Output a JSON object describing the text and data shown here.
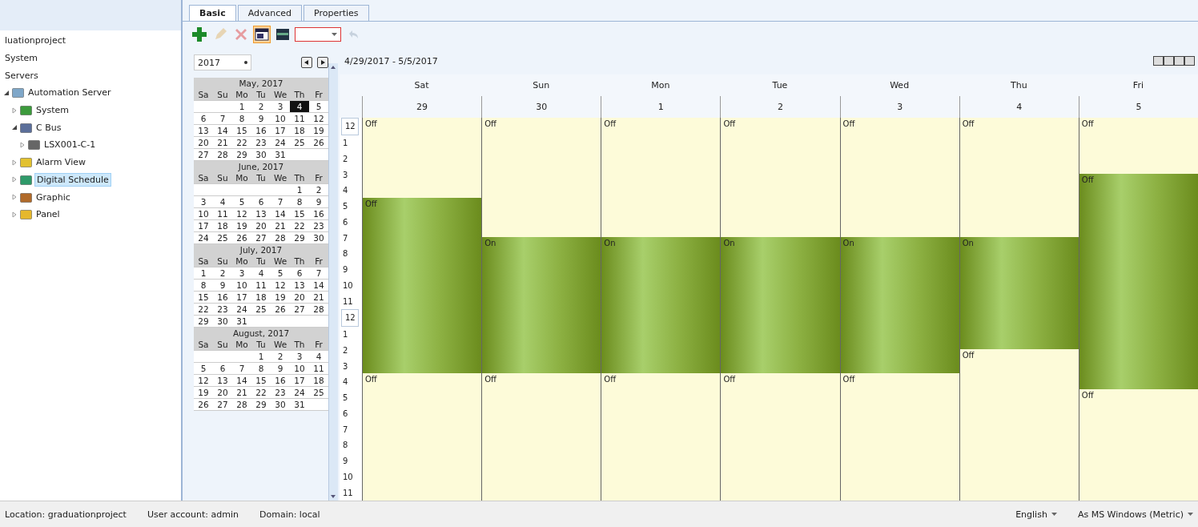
{
  "tree": {
    "items": [
      {
        "label": "luationproject",
        "kind": "plain",
        "selected": false
      },
      {
        "label": "System",
        "kind": "plain",
        "selected": false
      },
      {
        "label": "Servers",
        "kind": "plain",
        "selected": false
      },
      {
        "label": "Automation Server",
        "kind": "server",
        "selected": false,
        "expanded": true,
        "children": [
          {
            "label": "System",
            "kind": "system",
            "selected": false,
            "expanded": false
          },
          {
            "label": "C Bus",
            "kind": "bus",
            "selected": false,
            "expanded": true,
            "children": [
              {
                "label": "LSX001-C-1",
                "kind": "device",
                "selected": false,
                "expanded": false
              }
            ]
          },
          {
            "label": "Alarm View",
            "kind": "alarm",
            "selected": false,
            "expanded": false
          },
          {
            "label": "Digital Schedule",
            "kind": "schedule",
            "selected": true,
            "expanded": false
          },
          {
            "label": "Graphic",
            "kind": "graphic",
            "selected": false,
            "expanded": false
          },
          {
            "label": "Panel",
            "kind": "panel",
            "selected": false,
            "expanded": false
          }
        ]
      }
    ]
  },
  "tabs": [
    {
      "label": "Basic",
      "selected": true
    },
    {
      "label": "Advanced",
      "selected": false
    },
    {
      "label": "Properties",
      "selected": false
    }
  ],
  "toolbar": [
    {
      "kind": "add",
      "disabled": false,
      "selected": false
    },
    {
      "kind": "edit",
      "disabled": true,
      "selected": false
    },
    {
      "kind": "delete",
      "disabled": true,
      "selected": false
    },
    {
      "kind": "week",
      "disabled": false,
      "selected": true
    },
    {
      "kind": "list",
      "disabled": false,
      "selected": false
    },
    {
      "kind": "combo",
      "disabled": false,
      "selected": false
    },
    {
      "kind": "undo",
      "disabled": true,
      "selected": false
    }
  ],
  "year": {
    "value": "2017"
  },
  "mini_calendars": [
    {
      "title": "May, 2017",
      "weekdays": [
        "Sa",
        "Su",
        "Mo",
        "Tu",
        "We",
        "Th",
        "Fr"
      ],
      "weeks": [
        [
          {
            "day": "1",
            "selected": false
          },
          {
            "day": "2",
            "selected": false
          },
          {
            "day": "3",
            "selected": false
          },
          {
            "day": "4",
            "selected": true
          },
          {
            "day": "5",
            "selected": false
          }
        ],
        [
          {
            "day": "6",
            "selected": false
          },
          {
            "day": "7",
            "selected": false
          },
          {
            "day": "8",
            "selected": false
          },
          {
            "day": "9",
            "selected": false
          },
          {
            "day": "10",
            "selected": false
          },
          {
            "day": "11",
            "selected": false
          },
          {
            "day": "12",
            "selected": false
          }
        ],
        [
          {
            "day": "13",
            "selected": false
          },
          {
            "day": "14",
            "selected": false
          },
          {
            "day": "15",
            "selected": false
          },
          {
            "day": "16",
            "selected": false
          },
          {
            "day": "17",
            "selected": false
          },
          {
            "day": "18",
            "selected": false
          },
          {
            "day": "19",
            "selected": false
          }
        ],
        [
          {
            "day": "20",
            "selected": false
          },
          {
            "day": "21",
            "selected": false
          },
          {
            "day": "22",
            "selected": false
          },
          {
            "day": "23",
            "selected": false
          },
          {
            "day": "24",
            "selected": false
          },
          {
            "day": "25",
            "selected": false
          },
          {
            "day": "26",
            "selected": false
          }
        ],
        [
          {
            "day": "27",
            "selected": false
          },
          {
            "day": "28",
            "selected": false
          },
          {
            "day": "29",
            "selected": false
          },
          {
            "day": "30",
            "selected": false
          },
          {
            "day": "31",
            "selected": false
          }
        ]
      ]
    },
    {
      "title": "June, 2017",
      "weekdays": [
        "Sa",
        "Su",
        "Mo",
        "Tu",
        "We",
        "Th",
        "Fr"
      ],
      "weeks": [
        [
          {
            "day": "1",
            "selected": false
          },
          {
            "day": "2",
            "selected": false
          }
        ],
        [
          {
            "day": "3",
            "selected": false
          },
          {
            "day": "4",
            "selected": false
          },
          {
            "day": "5",
            "selected": false
          },
          {
            "day": "6",
            "selected": false
          },
          {
            "day": "7",
            "selected": false
          },
          {
            "day": "8",
            "selected": false
          },
          {
            "day": "9",
            "selected": false
          }
        ],
        [
          {
            "day": "10",
            "selected": false
          },
          {
            "day": "11",
            "selected": false
          },
          {
            "day": "12",
            "selected": false
          },
          {
            "day": "13",
            "selected": false
          },
          {
            "day": "14",
            "selected": false
          },
          {
            "day": "15",
            "selected": false
          },
          {
            "day": "16",
            "selected": false
          }
        ],
        [
          {
            "day": "17",
            "selected": false
          },
          {
            "day": "18",
            "selected": false
          },
          {
            "day": "19",
            "selected": false
          },
          {
            "day": "20",
            "selected": false
          },
          {
            "day": "21",
            "selected": false
          },
          {
            "day": "22",
            "selected": false
          },
          {
            "day": "23",
            "selected": false
          }
        ],
        [
          {
            "day": "24",
            "selected": false
          },
          {
            "day": "25",
            "selected": false
          },
          {
            "day": "26",
            "selected": false
          },
          {
            "day": "27",
            "selected": false
          },
          {
            "day": "28",
            "selected": false
          },
          {
            "day": "29",
            "selected": false
          },
          {
            "day": "30",
            "selected": false
          }
        ]
      ]
    },
    {
      "title": "July, 2017",
      "weekdays": [
        "Sa",
        "Su",
        "Mo",
        "Tu",
        "We",
        "Th",
        "Fr"
      ],
      "weeks": [
        [
          {
            "day": "1",
            "selected": false
          },
          {
            "day": "2",
            "selected": false
          },
          {
            "day": "3",
            "selected": false
          },
          {
            "day": "4",
            "selected": false
          },
          {
            "day": "5",
            "selected": false
          },
          {
            "day": "6",
            "selected": false
          },
          {
            "day": "7",
            "selected": false
          }
        ],
        [
          {
            "day": "8",
            "selected": false
          },
          {
            "day": "9",
            "selected": false
          },
          {
            "day": "10",
            "selected": false
          },
          {
            "day": "11",
            "selected": false
          },
          {
            "day": "12",
            "selected": false
          },
          {
            "day": "13",
            "selected": false
          },
          {
            "day": "14",
            "selected": false
          }
        ],
        [
          {
            "day": "15",
            "selected": false
          },
          {
            "day": "16",
            "selected": false
          },
          {
            "day": "17",
            "selected": false
          },
          {
            "day": "18",
            "selected": false
          },
          {
            "day": "19",
            "selected": false
          },
          {
            "day": "20",
            "selected": false
          },
          {
            "day": "21",
            "selected": false
          }
        ],
        [
          {
            "day": "22",
            "selected": false
          },
          {
            "day": "23",
            "selected": false
          },
          {
            "day": "24",
            "selected": false
          },
          {
            "day": "25",
            "selected": false
          },
          {
            "day": "26",
            "selected": false
          },
          {
            "day": "27",
            "selected": false
          },
          {
            "day": "28",
            "selected": false
          }
        ],
        [
          {
            "day": "29",
            "selected": false
          },
          {
            "day": "30",
            "selected": false
          },
          {
            "day": "31",
            "selected": false
          }
        ]
      ]
    },
    {
      "title": "August, 2017",
      "weekdays": [
        "Sa",
        "Su",
        "Mo",
        "Tu",
        "We",
        "Th",
        "Fr"
      ],
      "weeks": [
        [
          {
            "day": "1",
            "selected": false
          },
          {
            "day": "2",
            "selected": false
          },
          {
            "day": "3",
            "selected": false
          },
          {
            "day": "4",
            "selected": false
          }
        ],
        [
          {
            "day": "5",
            "selected": false
          },
          {
            "day": "6",
            "selected": false
          },
          {
            "day": "7",
            "selected": false
          },
          {
            "day": "8",
            "selected": false
          },
          {
            "day": "9",
            "selected": false
          },
          {
            "day": "10",
            "selected": false
          },
          {
            "day": "11",
            "selected": false
          }
        ],
        [
          {
            "day": "12",
            "selected": false
          },
          {
            "day": "13",
            "selected": false
          },
          {
            "day": "14",
            "selected": false
          },
          {
            "day": "15",
            "selected": false
          },
          {
            "day": "16",
            "selected": false
          },
          {
            "day": "17",
            "selected": false
          },
          {
            "day": "18",
            "selected": false
          }
        ],
        [
          {
            "day": "19",
            "selected": false
          },
          {
            "day": "20",
            "selected": false
          },
          {
            "day": "21",
            "selected": false
          },
          {
            "day": "22",
            "selected": false
          },
          {
            "day": "23",
            "selected": false
          },
          {
            "day": "24",
            "selected": false
          },
          {
            "day": "25",
            "selected": false
          }
        ],
        [
          {
            "day": "26",
            "selected": false
          },
          {
            "day": "27",
            "selected": false
          },
          {
            "day": "28",
            "selected": false
          },
          {
            "day": "29",
            "selected": false
          },
          {
            "day": "30",
            "selected": false
          },
          {
            "day": "31",
            "selected": false
          }
        ]
      ]
    }
  ],
  "schedule": {
    "range": "4/29/2017 - 5/5/2017",
    "hours": [
      "12",
      "1",
      "2",
      "3",
      "4",
      "5",
      "6",
      "7",
      "8",
      "9",
      "10",
      "11",
      "12",
      "1",
      "2",
      "3",
      "4",
      "5",
      "6",
      "7",
      "8",
      "9",
      "10",
      "11"
    ],
    "days": [
      {
        "name": "Sat",
        "date": "29",
        "labels": [
          "Off",
          "Off",
          "Off"
        ],
        "slots": [
          false,
          false,
          false,
          false,
          false,
          false,
          false,
          false,
          false,
          false,
          true,
          true,
          true,
          true,
          true,
          true,
          true,
          true,
          true,
          true,
          true,
          true,
          true,
          true,
          true,
          true,
          true,
          true,
          true,
          true,
          true,
          true,
          false,
          false,
          false,
          false,
          false,
          false,
          false,
          false,
          false,
          false,
          false,
          false,
          false,
          false,
          false,
          false
        ]
      },
      {
        "name": "Sun",
        "date": "30",
        "labels": [
          "Off",
          "On",
          "Off"
        ],
        "slots": [
          false,
          false,
          false,
          false,
          false,
          false,
          false,
          false,
          false,
          false,
          false,
          false,
          false,
          false,
          false,
          true,
          true,
          true,
          true,
          true,
          true,
          true,
          true,
          true,
          true,
          true,
          true,
          true,
          true,
          true,
          true,
          true,
          false,
          false,
          false,
          false,
          false,
          false,
          false,
          false,
          false,
          false,
          false,
          false,
          false,
          false,
          false,
          false
        ]
      },
      {
        "name": "Mon",
        "date": "1",
        "labels": [
          "Off",
          "On",
          "Off"
        ],
        "slots": [
          false,
          false,
          false,
          false,
          false,
          false,
          false,
          false,
          false,
          false,
          false,
          false,
          false,
          false,
          false,
          true,
          true,
          true,
          true,
          true,
          true,
          true,
          true,
          true,
          true,
          true,
          true,
          true,
          true,
          true,
          true,
          true,
          false,
          false,
          false,
          false,
          false,
          false,
          false,
          false,
          false,
          false,
          false,
          false,
          false,
          false,
          false,
          false
        ]
      },
      {
        "name": "Tue",
        "date": "2",
        "labels": [
          "Off",
          "On",
          "Off"
        ],
        "slots": [
          false,
          false,
          false,
          false,
          false,
          false,
          false,
          false,
          false,
          false,
          false,
          false,
          false,
          false,
          false,
          true,
          true,
          true,
          true,
          true,
          true,
          true,
          true,
          true,
          true,
          true,
          true,
          true,
          true,
          true,
          true,
          true,
          false,
          false,
          false,
          false,
          false,
          false,
          false,
          false,
          false,
          false,
          false,
          false,
          false,
          false,
          false,
          false
        ]
      },
      {
        "name": "Wed",
        "date": "3",
        "labels": [
          "Off",
          "On",
          "Off"
        ],
        "slots": [
          false,
          false,
          false,
          false,
          false,
          false,
          false,
          false,
          false,
          false,
          false,
          false,
          false,
          false,
          false,
          true,
          true,
          true,
          true,
          true,
          true,
          true,
          true,
          true,
          true,
          true,
          true,
          true,
          true,
          true,
          true,
          true,
          false,
          false,
          false,
          false,
          false,
          false,
          false,
          false,
          false,
          false,
          false,
          false,
          false,
          false,
          false,
          false
        ]
      },
      {
        "name": "Thu",
        "date": "4",
        "labels": [
          "Off",
          "On",
          "Off"
        ],
        "slots": [
          false,
          false,
          false,
          false,
          false,
          false,
          false,
          false,
          false,
          false,
          false,
          false,
          false,
          false,
          false,
          true,
          true,
          true,
          true,
          true,
          true,
          true,
          true,
          true,
          true,
          true,
          true,
          true,
          true,
          false,
          false,
          false,
          false,
          false,
          false,
          false,
          false,
          false,
          false,
          false,
          false,
          false,
          false,
          false,
          false,
          false,
          false,
          false
        ]
      },
      {
        "name": "Fri",
        "date": "5",
        "labels": [
          "Off",
          "Off",
          "Off"
        ],
        "slots": [
          false,
          false,
          false,
          false,
          false,
          false,
          false,
          true,
          true,
          true,
          true,
          true,
          true,
          true,
          true,
          true,
          true,
          true,
          true,
          true,
          true,
          true,
          true,
          true,
          true,
          true,
          true,
          true,
          true,
          true,
          true,
          true,
          true,
          true,
          false,
          false,
          false,
          false,
          false,
          false,
          false,
          false,
          false,
          false,
          false,
          false,
          false,
          false
        ]
      }
    ]
  },
  "status_bar": {
    "location": "Location: graduationproject",
    "user": "User account: admin",
    "domain": "Domain: local",
    "language": "English",
    "units": "As MS Windows (Metric)"
  }
}
